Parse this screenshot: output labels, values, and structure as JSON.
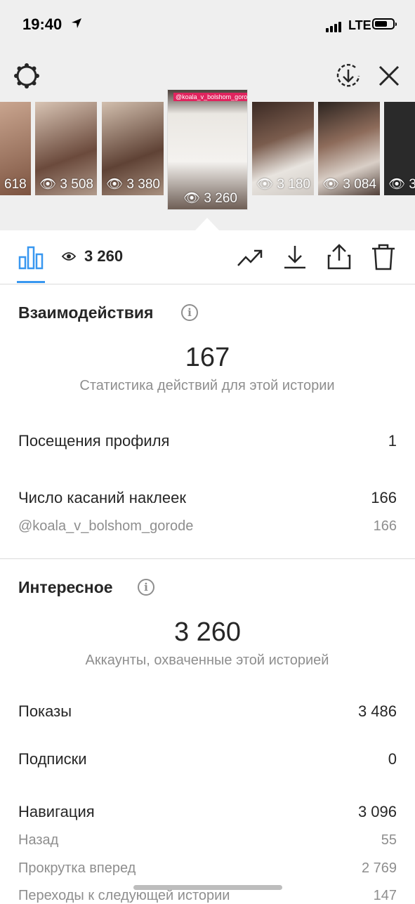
{
  "status_bar": {
    "time": "19:40",
    "network": "LTE"
  },
  "thumbnails": [
    {
      "views": "618"
    },
    {
      "views": "3 508"
    },
    {
      "views": "3 380"
    },
    {
      "views": "3 260",
      "active": true,
      "tag": "@koala_v_bolshom_gorode"
    },
    {
      "views": "3 180"
    },
    {
      "views": "3 084"
    },
    {
      "views": "3"
    }
  ],
  "toolbar": {
    "views": "3 260",
    "icons": [
      "bar-chart-icon",
      "eye-icon",
      "trend-icon",
      "download-icon",
      "share-icon",
      "trash-icon"
    ]
  },
  "interactions": {
    "title": "Взаимодействия",
    "total": "167",
    "caption": "Статистика действий для этой истории",
    "rows": [
      {
        "label": "Посещения профиля",
        "value": "1"
      },
      {
        "label": "Число касаний наклеек",
        "value": "166"
      }
    ],
    "sub_rows": [
      {
        "label": "@koala_v_bolshom_gorode",
        "value": "166"
      }
    ]
  },
  "discovery": {
    "title": "Интересное",
    "total": "3 260",
    "caption": "Аккаунты, охваченные этой историей",
    "rows": [
      {
        "label": "Показы",
        "value": "3 486"
      },
      {
        "label": "Подписки",
        "value": "0"
      },
      {
        "label": "Навигация",
        "value": "3 096"
      }
    ],
    "sub_rows": [
      {
        "label": "Назад",
        "value": "55"
      },
      {
        "label": "Прокрутка вперед",
        "value": "2 769"
      },
      {
        "label": "Переходы к следующей истории",
        "value": "147"
      }
    ]
  },
  "colors": {
    "accent": "#3897f0",
    "text": "#262626",
    "secondary": "#8e8e8e",
    "header_bg": "#efefef"
  }
}
